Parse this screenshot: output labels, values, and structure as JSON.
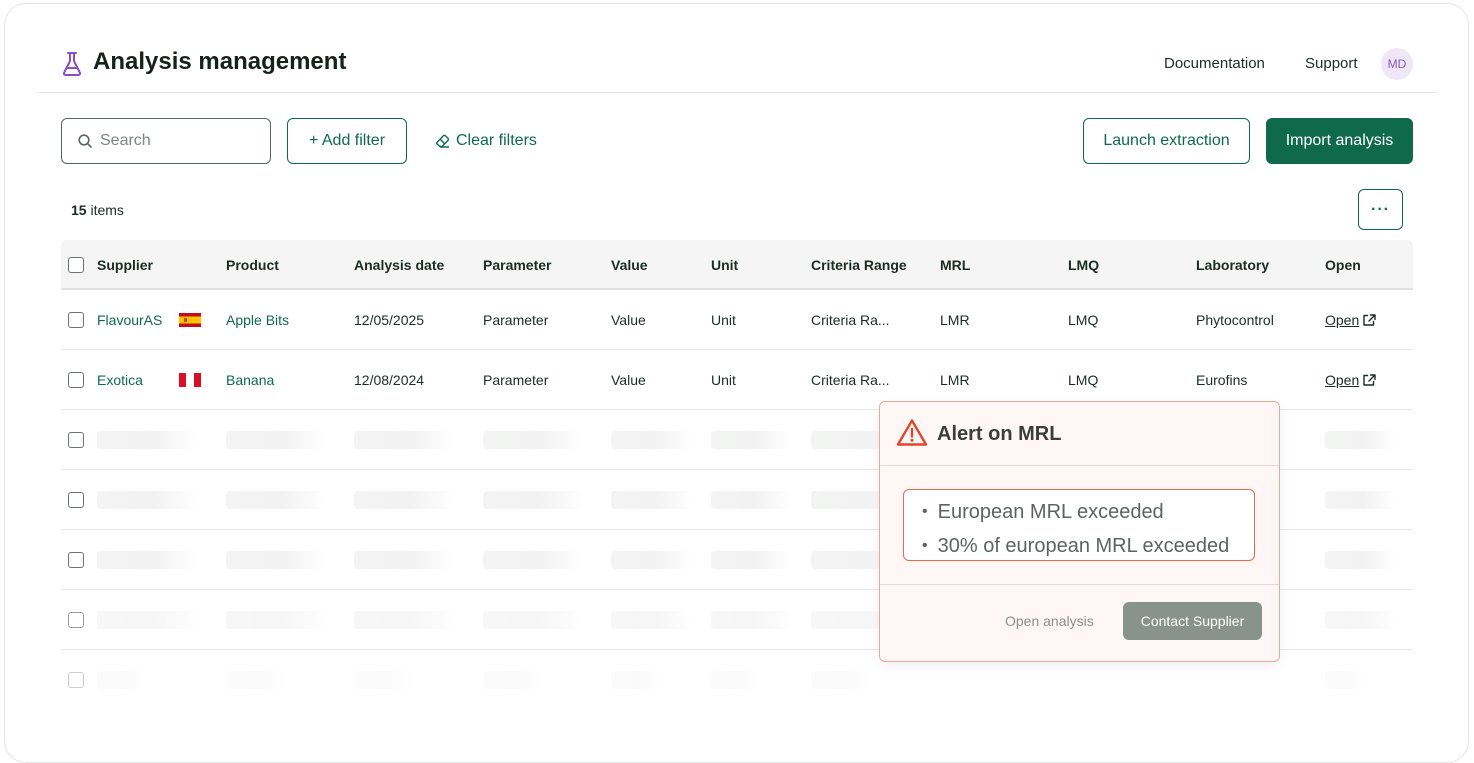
{
  "header": {
    "title": "Analysis management",
    "links": [
      "Documentation",
      "Support"
    ],
    "avatar_initials": "MD"
  },
  "toolbar": {
    "search_placeholder": "Search",
    "add_filter": "+ Add filter",
    "clear_filters": "Clear filters",
    "launch_extraction": "Launch extraction",
    "import_analysis": "Import analysis"
  },
  "list": {
    "count": "15",
    "count_label": "items",
    "more_label": "···"
  },
  "table": {
    "columns": [
      "Supplier",
      "Product",
      "Analysis date",
      "Parameter",
      "Value",
      "Unit",
      "Criteria Range",
      "MRL",
      "LMQ",
      "Laboratory",
      "Open"
    ],
    "rows": [
      {
        "supplier": "FlavourAS",
        "flag": "spain-flag-icon",
        "product": "Apple Bits",
        "date": "12/05/2025",
        "parameter": "Parameter",
        "value": "Value",
        "unit": "Unit",
        "criteria": "Criteria Ra...",
        "mrl": "LMR",
        "lmq": "LMQ",
        "laboratory": "Phytocontrol",
        "open": "Open"
      },
      {
        "supplier": "Exotica",
        "flag": "peru-flag-icon",
        "product": "Banana",
        "date": "12/08/2024",
        "parameter": "Parameter",
        "value": "Value",
        "unit": "Unit",
        "criteria": "Criteria Ra...",
        "mrl": "LMR",
        "lmq": "LMQ",
        "laboratory": "Eurofins",
        "open": "Open"
      }
    ]
  },
  "alert": {
    "title": "Alert on MRL",
    "items": [
      "European MRL exceeded",
      "30% of european MRL exceeded"
    ],
    "open_analysis": "Open analysis",
    "contact_supplier": "Contact Supplier"
  },
  "colors": {
    "brand": "#0f6a4c",
    "alert_border": "#e26b55",
    "alert_bg": "#fff7f5",
    "avatar_bg": "#efe6f8"
  }
}
